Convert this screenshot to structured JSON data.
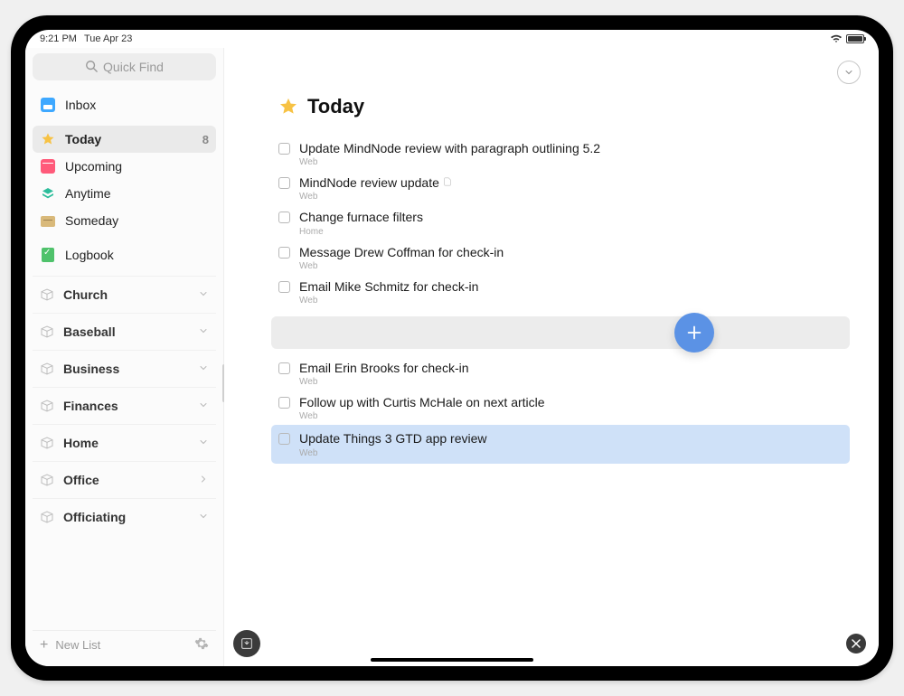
{
  "statusbar": {
    "time": "9:21 PM",
    "date": "Tue Apr 23"
  },
  "sidebar": {
    "quickfind_placeholder": "Quick Find",
    "smart": [
      {
        "label": "Inbox"
      },
      {
        "label": "Today",
        "badge": "8",
        "selected": true
      },
      {
        "label": "Upcoming"
      },
      {
        "label": "Anytime"
      },
      {
        "label": "Someday"
      }
    ],
    "logbook": {
      "label": "Logbook"
    },
    "areas": [
      {
        "label": "Church",
        "chev": "down"
      },
      {
        "label": "Baseball",
        "chev": "down"
      },
      {
        "label": "Business",
        "chev": "down"
      },
      {
        "label": "Finances",
        "chev": "down"
      },
      {
        "label": "Home",
        "chev": "down"
      },
      {
        "label": "Office",
        "chev": "right"
      },
      {
        "label": "Officiating",
        "chev": "down"
      }
    ],
    "new_list_label": "New List"
  },
  "main": {
    "title": "Today",
    "tasks_before": [
      {
        "title": "Update MindNode review with paragraph outlining 5.2",
        "tag": "Web"
      },
      {
        "title": "MindNode review update",
        "tag": "Web",
        "attachment": true
      },
      {
        "title": "Change furnace filters",
        "tag": "Home"
      },
      {
        "title": "Message Drew Coffman for check-in",
        "tag": "Web"
      },
      {
        "title": "Email Mike Schmitz for check-in",
        "tag": "Web"
      }
    ],
    "tasks_after": [
      {
        "title": "Email Erin Brooks for check-in",
        "tag": "Web"
      },
      {
        "title": "Follow up with Curtis McHale on next article",
        "tag": "Web"
      },
      {
        "title": "Update Things 3 GTD app review",
        "tag": "Web",
        "highlighted": true
      }
    ]
  }
}
